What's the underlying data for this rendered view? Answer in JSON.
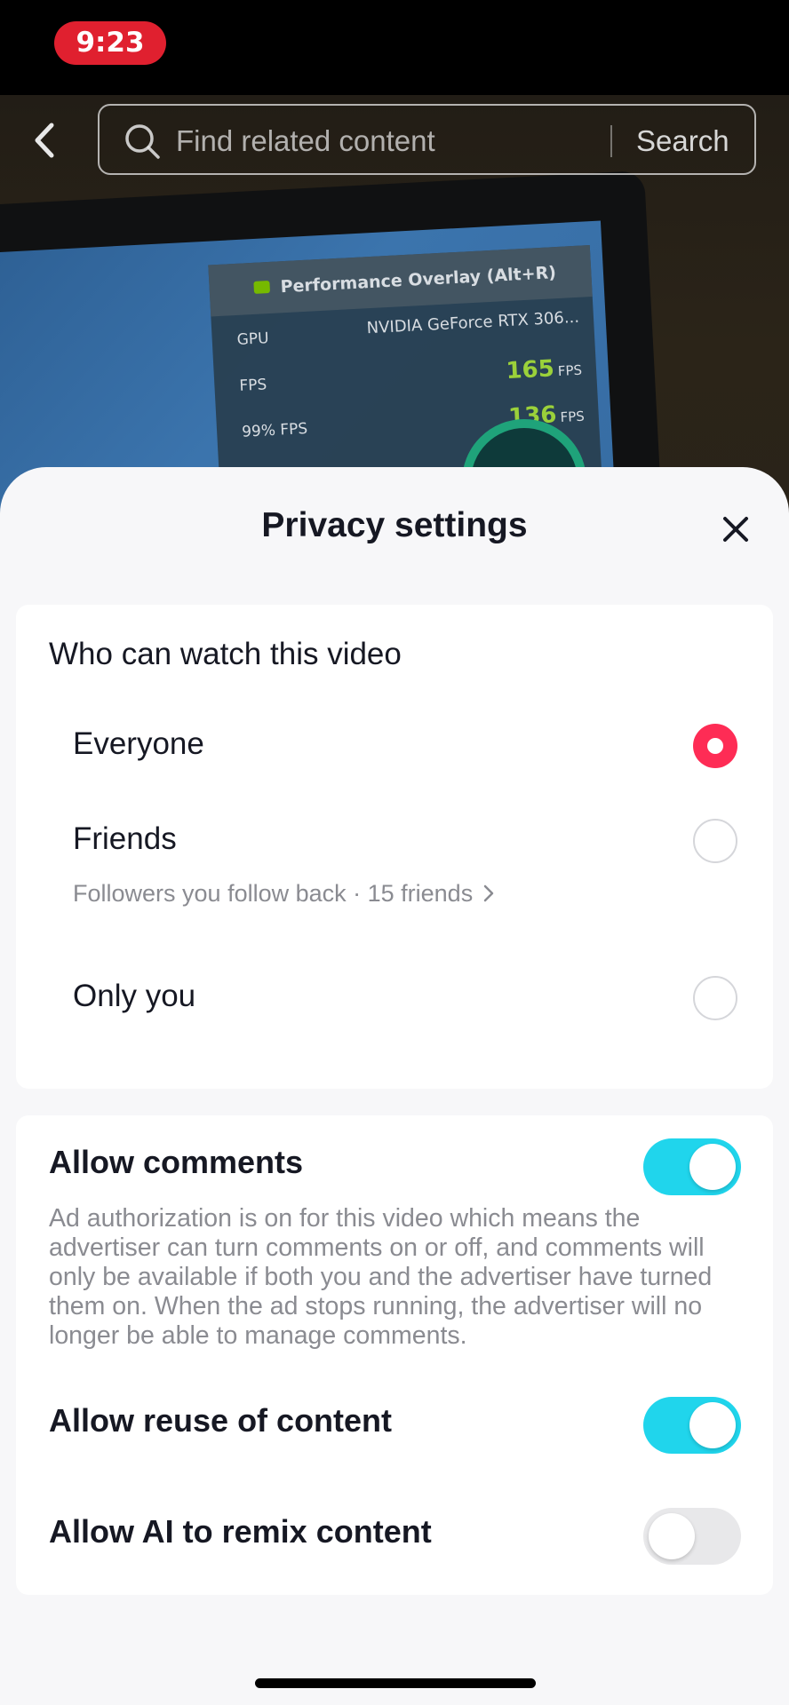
{
  "status_bar": {
    "time": "9:23"
  },
  "search": {
    "placeholder": "Find related content",
    "button_label": "Search"
  },
  "video_overlay": {
    "header": "Performance Overlay (Alt+R)",
    "rows": [
      {
        "label": "GPU",
        "value": "NVIDIA GeForce RTX 306..."
      },
      {
        "label": "FPS",
        "value": "165",
        "unit": "FPS"
      },
      {
        "label": "99% FPS",
        "value": "136",
        "unit": "FPS"
      }
    ]
  },
  "sheet": {
    "title": "Privacy settings",
    "visibility": {
      "heading": "Who can watch this video",
      "options": [
        {
          "label": "Everyone",
          "checked": true
        },
        {
          "label": "Friends",
          "sub": "Followers you follow back · 15 friends",
          "checked": false
        },
        {
          "label": "Only you",
          "checked": false
        }
      ]
    },
    "permissions": [
      {
        "label": "Allow comments",
        "enabled": true,
        "description": "Ad authorization is on for this video which means the advertiser can turn comments on or off, and comments will only be available if both you and the advertiser have turned them on. When the ad stops running, the advertiser will no longer be able to manage comments."
      },
      {
        "label": "Allow reuse of content",
        "enabled": true
      },
      {
        "label": "Allow AI to remix content",
        "enabled": false
      }
    ]
  },
  "colors": {
    "accent_radio": "#fe2c55",
    "toggle_on": "#20d5ec",
    "toggle_off": "#e8e8ea",
    "time_pill": "#e0202f"
  }
}
